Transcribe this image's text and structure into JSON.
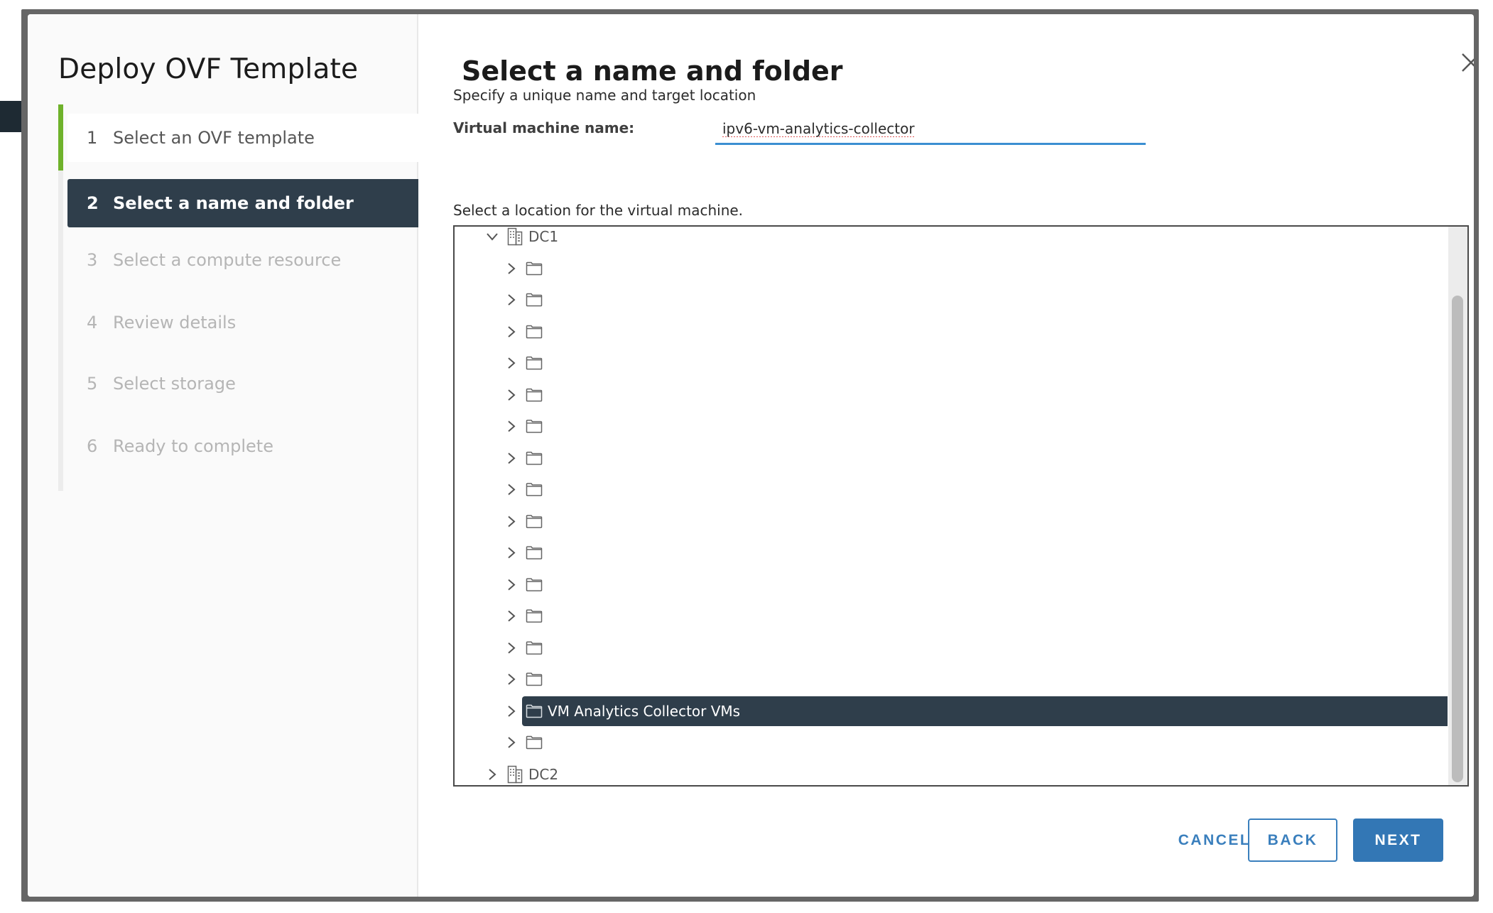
{
  "wizard": {
    "title": "Deploy OVF Template",
    "steps": [
      {
        "number": "1",
        "label": "Select an OVF template",
        "state": "done"
      },
      {
        "number": "2",
        "label": "Select a name and folder",
        "state": "active"
      },
      {
        "number": "3",
        "label": "Select a compute resource",
        "state": "pending"
      },
      {
        "number": "4",
        "label": "Review details",
        "state": "pending"
      },
      {
        "number": "5",
        "label": "Select storage",
        "state": "pending"
      },
      {
        "number": "6",
        "label": "Ready to complete",
        "state": "pending"
      }
    ]
  },
  "page": {
    "title": "Select a name and folder",
    "subtitle": "Specify a unique name and target location",
    "vm_name_label": "Virtual machine name:",
    "vm_name_value": "ipv6-vm-analytics-collector",
    "location_label": "Select a location for the virtual machine.",
    "close_icon": "close-icon"
  },
  "tree": {
    "scroll_position": 0.12,
    "scroll_visible_fraction": 0.88,
    "nodes": [
      {
        "type": "datacenter",
        "label": "DC1",
        "expanded": true,
        "level": 0
      },
      {
        "type": "folder",
        "label": "",
        "level": 1
      },
      {
        "type": "folder",
        "label": "",
        "level": 1
      },
      {
        "type": "folder",
        "label": "",
        "level": 1
      },
      {
        "type": "folder",
        "label": "",
        "level": 1
      },
      {
        "type": "folder",
        "label": "",
        "level": 1
      },
      {
        "type": "folder",
        "label": "",
        "level": 1
      },
      {
        "type": "folder",
        "label": "",
        "level": 1
      },
      {
        "type": "folder",
        "label": "",
        "level": 1
      },
      {
        "type": "folder",
        "label": "",
        "level": 1
      },
      {
        "type": "folder",
        "label": "",
        "level": 1
      },
      {
        "type": "folder",
        "label": "",
        "level": 1
      },
      {
        "type": "folder",
        "label": "",
        "level": 1
      },
      {
        "type": "folder",
        "label": "",
        "level": 1
      },
      {
        "type": "folder",
        "label": "",
        "level": 1
      },
      {
        "type": "folder",
        "label": "VM Analytics Collector VMs",
        "level": 1,
        "selected": true
      },
      {
        "type": "folder",
        "label": "",
        "level": 1
      },
      {
        "type": "datacenter",
        "label": "DC2",
        "expanded": false,
        "level": 0
      }
    ]
  },
  "footer": {
    "cancel_label": "CANCEL",
    "back_label": "BACK",
    "next_label": "NEXT"
  },
  "colors": {
    "accent": "#3377b5",
    "active_step": "#2f3e4b",
    "completed_step": "#6fb22b",
    "input_underline": "#3b8fd2"
  }
}
